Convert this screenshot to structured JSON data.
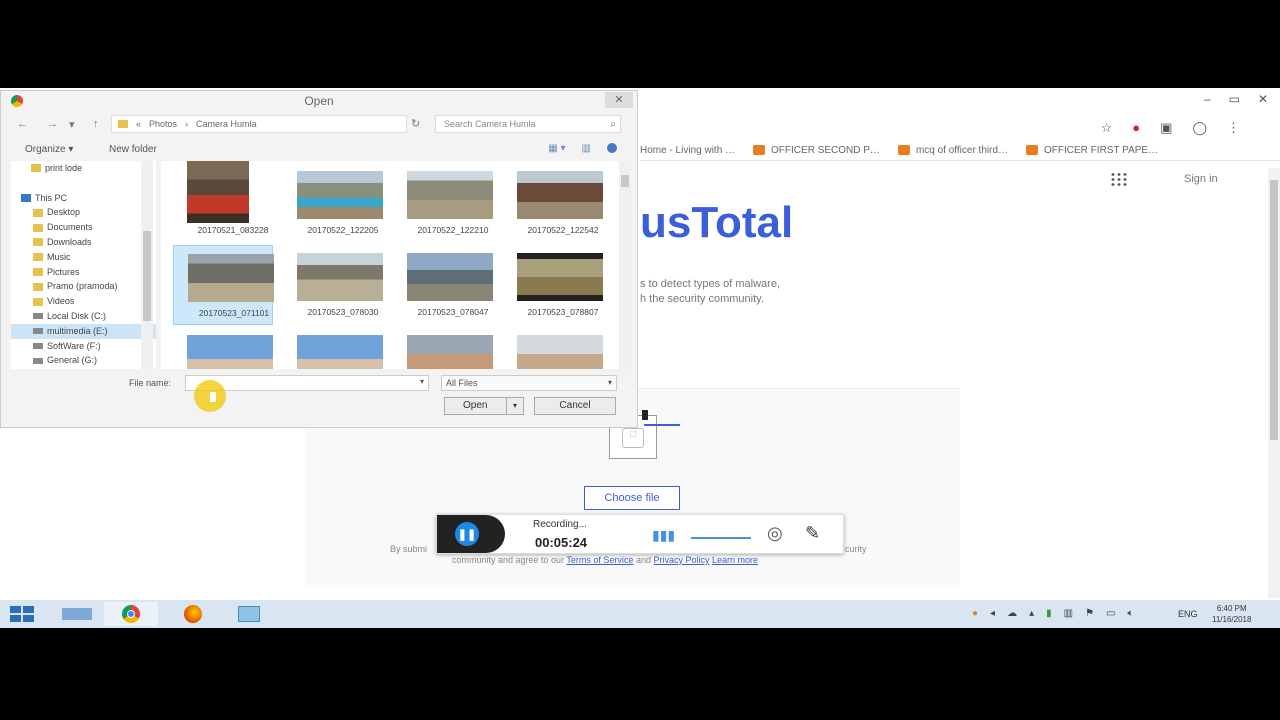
{
  "browser": {
    "bookmarks": [
      {
        "label": "Home - Living with …"
      },
      {
        "label": "OFFICER SECOND P…"
      },
      {
        "label": "mcq of officer third…"
      },
      {
        "label": "OFFICER FIRST PAPE…"
      }
    ],
    "sign_in": "Sign in",
    "logo_text": "usTotal",
    "subtitle_line1": "s to detect types of malware,",
    "subtitle_line2": "h the security community.",
    "choose_file": "Choose file",
    "terms_left": "By submi",
    "terms_right": "curity",
    "terms_line_prefix": "community and agree to our",
    "terms_link": "Terms of Service",
    "terms_and": "and",
    "privacy_link": "Privacy Policy",
    "learn_more": "Learn more"
  },
  "recorder": {
    "label": "Recording...",
    "time": "00:05:24"
  },
  "dialog": {
    "title": "Open",
    "close_glyph": "✕",
    "path": [
      "Photos",
      "Camera Humla"
    ],
    "search_placeholder": "Search Camera Humla",
    "organize": "Organize ▾",
    "new_folder": "New folder",
    "nav_items": [
      {
        "label": "print lode",
        "icon": "folder"
      },
      {
        "label": "",
        "icon": "none"
      },
      {
        "label": "This PC",
        "icon": "pc"
      },
      {
        "label": "Desktop",
        "icon": "folder"
      },
      {
        "label": "Documents",
        "icon": "folder"
      },
      {
        "label": "Downloads",
        "icon": "folder"
      },
      {
        "label": "Music",
        "icon": "folder"
      },
      {
        "label": "Pictures",
        "icon": "folder"
      },
      {
        "label": "Pramo (pramoda)",
        "icon": "folder"
      },
      {
        "label": "Videos",
        "icon": "folder"
      },
      {
        "label": "Local Disk (C:)",
        "icon": "drive"
      },
      {
        "label": "multimedia (E:)",
        "icon": "drive"
      },
      {
        "label": "SoftWare (F:)",
        "icon": "drive"
      },
      {
        "label": "General (G:)",
        "icon": "drive"
      }
    ],
    "files": [
      {
        "name": "20170521_083228",
        "scene": "person-red"
      },
      {
        "name": "20170522_122205",
        "scene": "pool-mountain"
      },
      {
        "name": "20170522_122210",
        "scene": "valley"
      },
      {
        "name": "20170522_122542",
        "scene": "houses"
      },
      {
        "name": "20170523_071101",
        "scene": "rocks",
        "selected": true
      },
      {
        "name": "20170523_078030",
        "scene": "hillside"
      },
      {
        "name": "20170523_078047",
        "scene": "mountain-sky"
      },
      {
        "name": "20170523_078807",
        "scene": "video-hill"
      },
      {
        "name": "",
        "scene": "sky-person"
      },
      {
        "name": "",
        "scene": "sky-person"
      },
      {
        "name": "",
        "scene": "portrait"
      },
      {
        "name": "",
        "scene": "portrait-light"
      }
    ],
    "file_name_label": "File name:",
    "file_name_value": "",
    "file_type": "All Files",
    "open_label": "Open",
    "cancel_label": "Cancel"
  },
  "taskbar": {
    "lang": "ENG",
    "time": "6:40 PM",
    "date": "11/16/2018"
  },
  "colors": {
    "accent": "#3a5fd8",
    "recorder_button": "#1e88e5"
  }
}
